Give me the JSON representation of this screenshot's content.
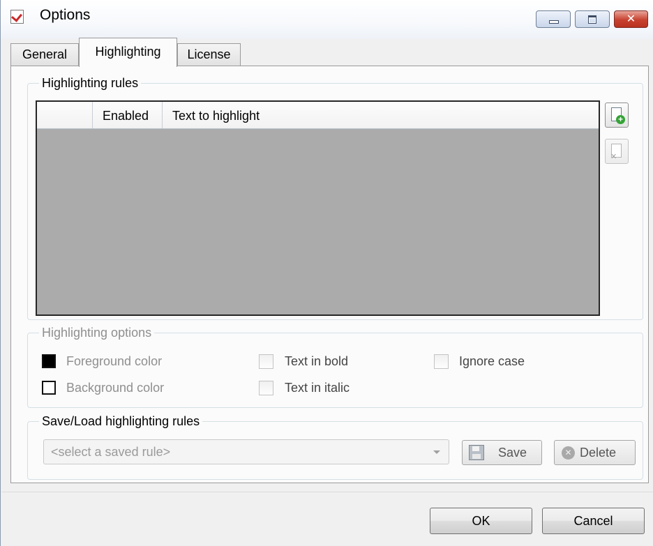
{
  "window": {
    "title": "Options",
    "icon": "checklist-app-icon"
  },
  "tabs": [
    {
      "label": "General",
      "active": false
    },
    {
      "label": "Highlighting",
      "active": true
    },
    {
      "label": "License",
      "active": false
    }
  ],
  "rules_group": {
    "label": "Highlighting rules",
    "columns": [
      "",
      "Enabled",
      "Text to highlight"
    ],
    "rows": [],
    "add_button_icon": "add-document-icon",
    "remove_button_icon": "remove-document-icon"
  },
  "options_group": {
    "label": "Highlighting options",
    "foreground": {
      "label": "Foreground color",
      "color": "#000000"
    },
    "background": {
      "label": "Background color",
      "color": "#ffffff"
    },
    "bold": {
      "label": "Text in bold",
      "checked": false
    },
    "italic": {
      "label": "Text in italic",
      "checked": false
    },
    "ignore_case": {
      "label": "Ignore case",
      "checked": false
    }
  },
  "saveload_group": {
    "label": "Save/Load highlighting rules",
    "select_placeholder": "<select a saved rule>",
    "save_label": "Save",
    "delete_label": "Delete"
  },
  "dialog": {
    "ok_label": "OK",
    "cancel_label": "Cancel"
  }
}
